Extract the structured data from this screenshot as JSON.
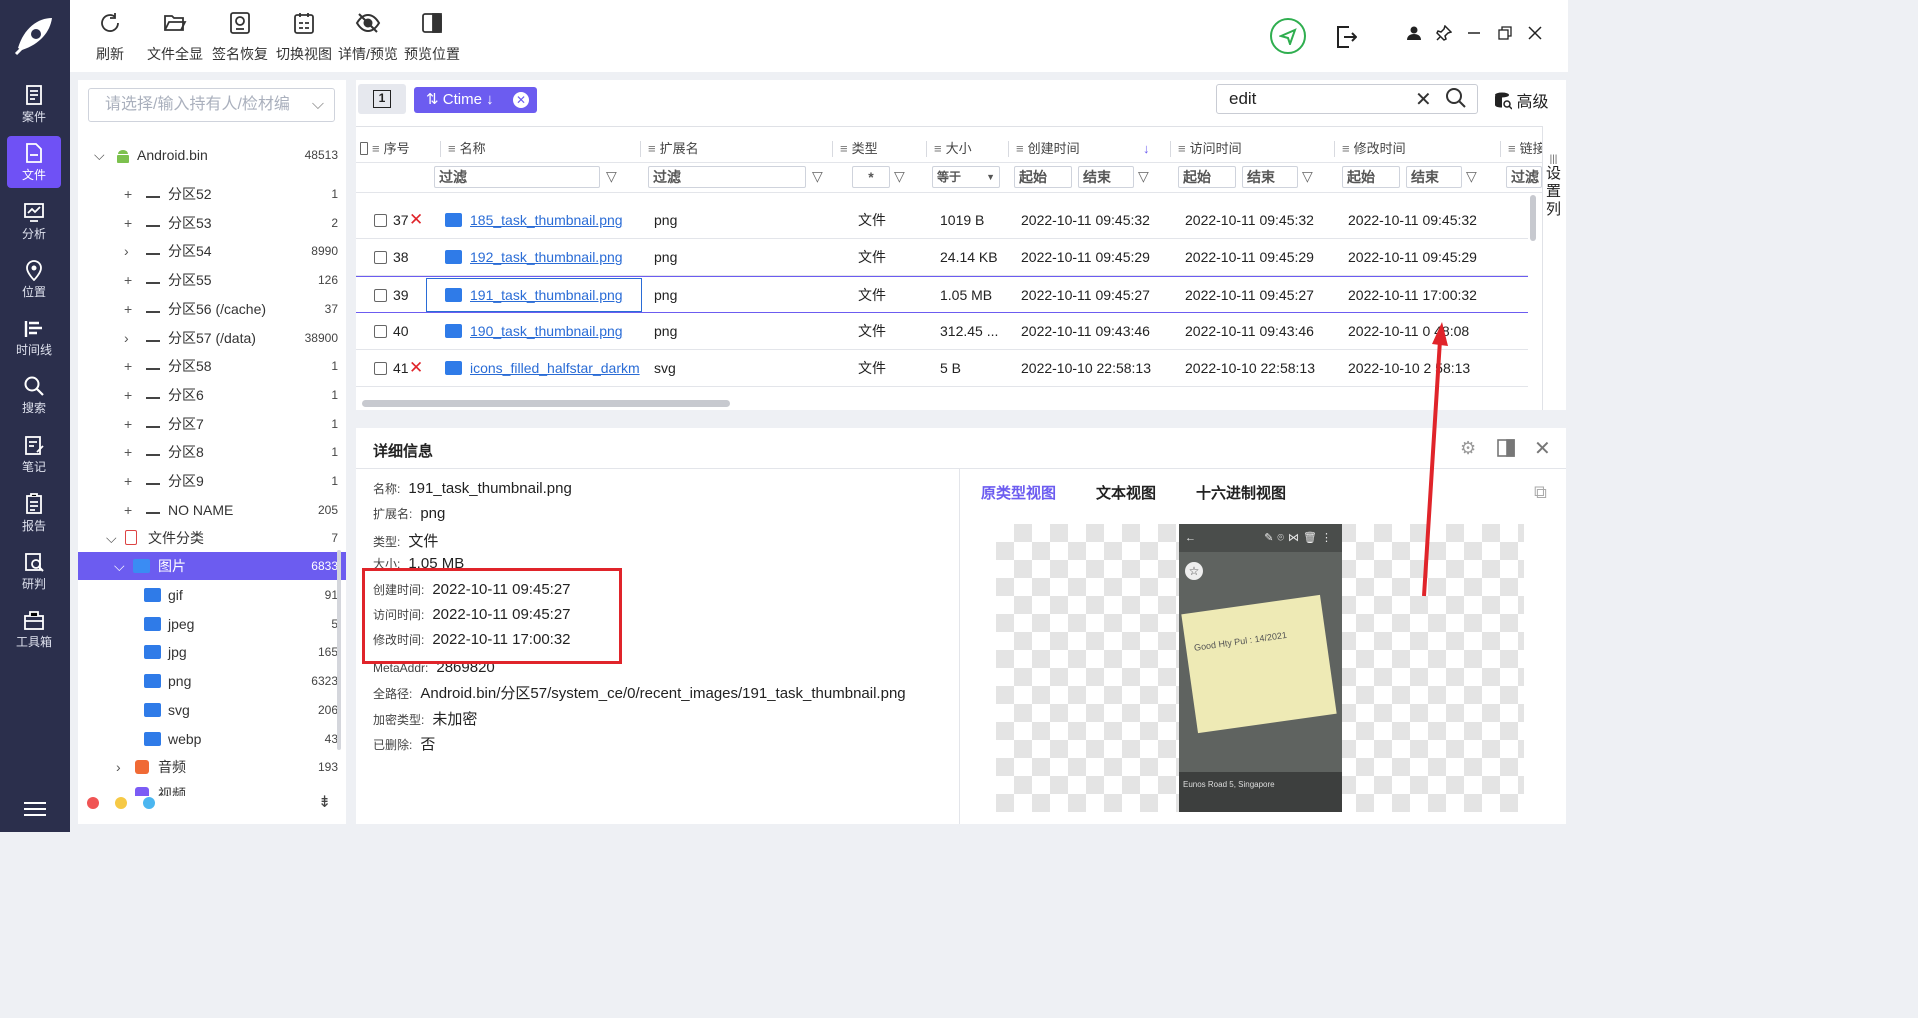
{
  "toolbar": {
    "buttons": [
      {
        "label": "刷新",
        "icon": "refresh-icon"
      },
      {
        "label": "文件全显",
        "icon": "folder-open-icon"
      },
      {
        "label": "签名恢复",
        "icon": "signature-restore-icon"
      },
      {
        "label": "切换视图",
        "icon": "switch-view-icon"
      },
      {
        "label": "详情/预览",
        "icon": "eye-slash-icon"
      },
      {
        "label": "预览位置",
        "icon": "layout-right-icon"
      }
    ]
  },
  "nav": {
    "items": [
      {
        "label": "案件",
        "icon": "case-icon"
      },
      {
        "label": "文件",
        "icon": "file-icon"
      },
      {
        "label": "分析",
        "icon": "analysis-icon"
      },
      {
        "label": "位置",
        "icon": "location-icon"
      },
      {
        "label": "时间线",
        "icon": "timeline-icon"
      },
      {
        "label": "搜索",
        "icon": "search-icon"
      },
      {
        "label": "笔记",
        "icon": "note-icon"
      },
      {
        "label": "报告",
        "icon": "report-icon"
      },
      {
        "label": "研判",
        "icon": "judge-icon"
      },
      {
        "label": "工具箱",
        "icon": "toolbox-icon"
      }
    ]
  },
  "tree": {
    "search_placeholder": "请选择/输入持有人/检材编",
    "root": {
      "label": "Android.bin",
      "count": "48513"
    },
    "partitions": [
      {
        "label": "分区52",
        "count": "1",
        "toggle": "+"
      },
      {
        "label": "分区53",
        "count": "2",
        "toggle": "+"
      },
      {
        "label": "分区54",
        "count": "8990",
        "toggle": ">"
      },
      {
        "label": "分区55",
        "count": "126",
        "toggle": "+"
      },
      {
        "label": "分区56 (/cache)",
        "count": "37",
        "toggle": "+"
      },
      {
        "label": "分区57 (/data)",
        "count": "38900",
        "toggle": ">"
      },
      {
        "label": "分区58",
        "count": "1",
        "toggle": "+"
      },
      {
        "label": "分区6",
        "count": "1",
        "toggle": "+"
      },
      {
        "label": "分区7",
        "count": "1",
        "toggle": "+"
      },
      {
        "label": "分区8",
        "count": "1",
        "toggle": "+"
      },
      {
        "label": "分区9",
        "count": "1",
        "toggle": "+"
      },
      {
        "label": "NO NAME",
        "count": "205",
        "toggle": "+"
      }
    ],
    "category": {
      "label": "文件分类",
      "count": "7"
    },
    "images": {
      "label": "图片",
      "count": "6833"
    },
    "image_types": [
      {
        "label": "gif",
        "count": "91"
      },
      {
        "label": "jpeg",
        "count": "5"
      },
      {
        "label": "jpg",
        "count": "165"
      },
      {
        "label": "png",
        "count": "6323"
      },
      {
        "label": "svg",
        "count": "206"
      },
      {
        "label": "webp",
        "count": "43"
      }
    ],
    "audio": {
      "label": "音频",
      "count": "193"
    },
    "video": {
      "label": "视频"
    }
  },
  "grid": {
    "page_btn": "1",
    "sort_tag": "Ctime",
    "search_value": "edit",
    "advanced_label": "高级",
    "settings_col_label": "设置列",
    "headers": [
      "序号",
      "名称",
      "扩展名",
      "类型",
      "大小",
      "创建时间",
      "访问时间",
      "修改时间",
      "链接"
    ],
    "filters": {
      "name": "过滤",
      "ext": "过滤",
      "type": "*",
      "size": "等于",
      "start": "起始",
      "end": "结束",
      "link": "过滤"
    },
    "rows": [
      {
        "no": "37",
        "deleted": true,
        "name": "185_task_thumbnail.png",
        "ext": "png",
        "type": "文件",
        "size": "1019 B",
        "ctime": "2022-10-11 09:45:32",
        "atime": "2022-10-11 09:45:32",
        "mtime": "2022-10-11 09:45:32"
      },
      {
        "no": "38",
        "deleted": false,
        "name": "192_task_thumbnail.png",
        "ext": "png",
        "type": "文件",
        "size": "24.14 KB",
        "ctime": "2022-10-11 09:45:29",
        "atime": "2022-10-11 09:45:29",
        "mtime": "2022-10-11 09:45:29"
      },
      {
        "no": "39",
        "deleted": false,
        "name": "191_task_thumbnail.png",
        "ext": "png",
        "type": "文件",
        "size": "1.05 MB",
        "ctime": "2022-10-11 09:45:27",
        "atime": "2022-10-11 09:45:27",
        "mtime": "2022-10-11 17:00:32"
      },
      {
        "no": "40",
        "deleted": false,
        "name": "190_task_thumbnail.png",
        "ext": "png",
        "type": "文件",
        "size": "312.45 ...",
        "ctime": "2022-10-11 09:43:46",
        "atime": "2022-10-11 09:43:46",
        "mtime": "2022-10-11 0 48:08"
      },
      {
        "no": "41",
        "deleted": true,
        "name": "icons_filled_halfstar_darkm",
        "ext": "svg",
        "type": "文件",
        "size": "5 B",
        "ctime": "2022-10-10 22:58:13",
        "atime": "2022-10-10 22:58:13",
        "mtime": "2022-10-10 2 58:13"
      }
    ]
  },
  "detail": {
    "title": "详细信息",
    "fields": [
      {
        "k": "名称:",
        "v": "191_task_thumbnail.png"
      },
      {
        "k": "扩展名:",
        "v": "png"
      },
      {
        "k": "类型:",
        "v": "文件"
      },
      {
        "k": "大小:",
        "v": "1.05 MB"
      },
      {
        "k": "创建时间:",
        "v": "2022-10-11 09:45:27"
      },
      {
        "k": "访问时间:",
        "v": "2022-10-11 09:45:27"
      },
      {
        "k": "修改时间:",
        "v": "2022-10-11 17:00:32"
      },
      {
        "k": "MetaAddr:",
        "v": "2869820"
      },
      {
        "k": "全路径:",
        "v": "Android.bin/分区57/system_ce/0/recent_images/191_task_thumbnail.png"
      },
      {
        "k": "加密类型:",
        "v": "未加密"
      },
      {
        "k": "已删除:",
        "v": "否"
      }
    ],
    "tabs": [
      "原类型视图",
      "文本视图",
      "十六进制视图"
    ],
    "note_text": "Good  Hty  Pul : 14/2021",
    "preview_caption": "Eunos Road 5, Singapore"
  },
  "colors": {
    "accent": "#6c5cf0",
    "nav_bg": "#2b2f4c",
    "highlight_red": "#e0242a",
    "link": "#2a6cd6"
  }
}
